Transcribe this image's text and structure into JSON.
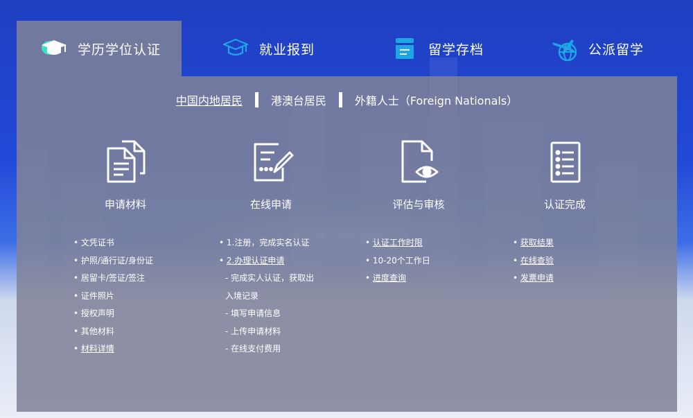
{
  "tabs": [
    {
      "label": "学历学位认证",
      "icon": "graduation-cap-icon",
      "active": true
    },
    {
      "label": "就业报到",
      "icon": "mortarboard-icon",
      "active": false
    },
    {
      "label": "留学存档",
      "icon": "archive-folder-icon",
      "active": false
    },
    {
      "label": "公派留学",
      "icon": "plane-globe-icon",
      "active": false
    }
  ],
  "subnav": [
    {
      "label": "中国内地居民",
      "active": true
    },
    {
      "label": "港澳台居民",
      "active": false
    },
    {
      "label": "外籍人士（Foreign Nationals）",
      "active": false
    }
  ],
  "steps": [
    {
      "title": "申请材料",
      "icon": "documents-icon"
    },
    {
      "title": "在线申请",
      "icon": "form-edit-icon"
    },
    {
      "title": "评估与审核",
      "icon": "file-review-eye-icon"
    },
    {
      "title": "认证完成",
      "icon": "checklist-icon"
    }
  ],
  "columns": {
    "materials": [
      "• 文凭证书",
      "• 护照/通行证/身份证",
      "• 居留卡/签证/签注",
      "• 证件照片",
      "• 授权声明",
      "• 其他材料"
    ],
    "materials_link": "材料详情",
    "online": {
      "line1": "• 1.注册，完成实名认证",
      "line2_link": "2.办理认证申请",
      "subs": [
        "- 完成实人认证，获取出",
        "入境记录",
        "- 填写申请信息",
        "- 上传申请材料",
        "- 在线支付费用"
      ]
    },
    "review": {
      "link1": "认证工作时限",
      "text": "• 10-20个工作日",
      "link2": "进度查询"
    },
    "complete": [
      "获取结果",
      "在线查验",
      "发票申请"
    ]
  },
  "colors": {
    "panel": "#80829a",
    "background": "#2148d8",
    "accent": "#1ea7e6"
  }
}
